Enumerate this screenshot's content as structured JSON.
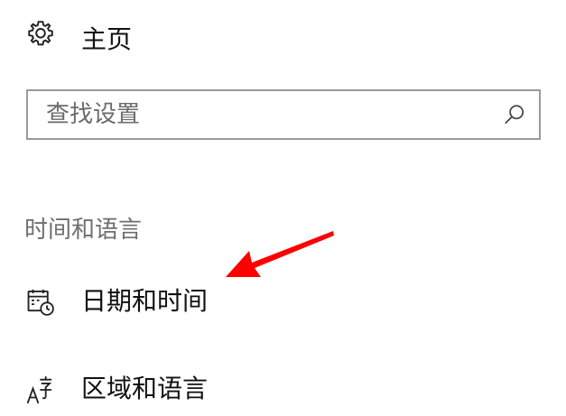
{
  "header": {
    "home_label": "主页",
    "home_icon": "gear-icon"
  },
  "search": {
    "placeholder": "查找设置",
    "value": "",
    "icon": "search-icon"
  },
  "section": {
    "heading": "时间和语言"
  },
  "nav": {
    "items": [
      {
        "label": "日期和时间",
        "icon": "calendar-clock-icon"
      },
      {
        "label": "区域和语言",
        "icon": "language-icon"
      }
    ]
  },
  "annotation": {
    "color": "#ff0000"
  }
}
